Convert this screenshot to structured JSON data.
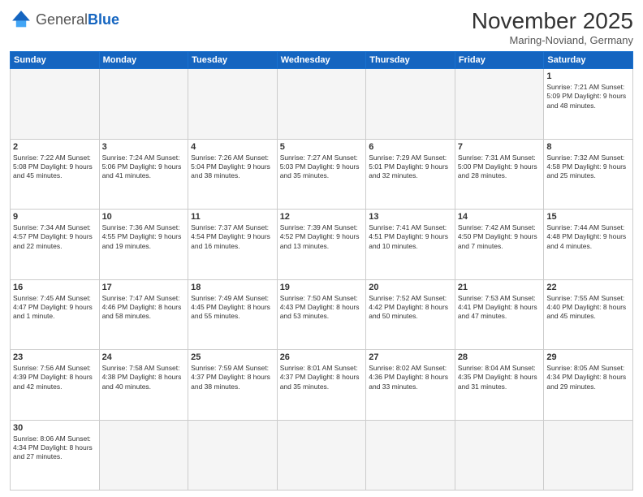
{
  "logo": {
    "general": "General",
    "blue": "Blue"
  },
  "title": "November 2025",
  "location": "Maring-Noviand, Germany",
  "headers": [
    "Sunday",
    "Monday",
    "Tuesday",
    "Wednesday",
    "Thursday",
    "Friday",
    "Saturday"
  ],
  "rows": [
    [
      {
        "num": "",
        "info": "",
        "empty": true
      },
      {
        "num": "",
        "info": "",
        "empty": true
      },
      {
        "num": "",
        "info": "",
        "empty": true
      },
      {
        "num": "",
        "info": "",
        "empty": true
      },
      {
        "num": "",
        "info": "",
        "empty": true
      },
      {
        "num": "",
        "info": "",
        "empty": true
      },
      {
        "num": "1",
        "info": "Sunrise: 7:21 AM\nSunset: 5:09 PM\nDaylight: 9 hours\nand 48 minutes.",
        "empty": false
      }
    ],
    [
      {
        "num": "2",
        "info": "Sunrise: 7:22 AM\nSunset: 5:08 PM\nDaylight: 9 hours\nand 45 minutes.",
        "empty": false
      },
      {
        "num": "3",
        "info": "Sunrise: 7:24 AM\nSunset: 5:06 PM\nDaylight: 9 hours\nand 41 minutes.",
        "empty": false
      },
      {
        "num": "4",
        "info": "Sunrise: 7:26 AM\nSunset: 5:04 PM\nDaylight: 9 hours\nand 38 minutes.",
        "empty": false
      },
      {
        "num": "5",
        "info": "Sunrise: 7:27 AM\nSunset: 5:03 PM\nDaylight: 9 hours\nand 35 minutes.",
        "empty": false
      },
      {
        "num": "6",
        "info": "Sunrise: 7:29 AM\nSunset: 5:01 PM\nDaylight: 9 hours\nand 32 minutes.",
        "empty": false
      },
      {
        "num": "7",
        "info": "Sunrise: 7:31 AM\nSunset: 5:00 PM\nDaylight: 9 hours\nand 28 minutes.",
        "empty": false
      },
      {
        "num": "8",
        "info": "Sunrise: 7:32 AM\nSunset: 4:58 PM\nDaylight: 9 hours\nand 25 minutes.",
        "empty": false
      }
    ],
    [
      {
        "num": "9",
        "info": "Sunrise: 7:34 AM\nSunset: 4:57 PM\nDaylight: 9 hours\nand 22 minutes.",
        "empty": false
      },
      {
        "num": "10",
        "info": "Sunrise: 7:36 AM\nSunset: 4:55 PM\nDaylight: 9 hours\nand 19 minutes.",
        "empty": false
      },
      {
        "num": "11",
        "info": "Sunrise: 7:37 AM\nSunset: 4:54 PM\nDaylight: 9 hours\nand 16 minutes.",
        "empty": false
      },
      {
        "num": "12",
        "info": "Sunrise: 7:39 AM\nSunset: 4:52 PM\nDaylight: 9 hours\nand 13 minutes.",
        "empty": false
      },
      {
        "num": "13",
        "info": "Sunrise: 7:41 AM\nSunset: 4:51 PM\nDaylight: 9 hours\nand 10 minutes.",
        "empty": false
      },
      {
        "num": "14",
        "info": "Sunrise: 7:42 AM\nSunset: 4:50 PM\nDaylight: 9 hours\nand 7 minutes.",
        "empty": false
      },
      {
        "num": "15",
        "info": "Sunrise: 7:44 AM\nSunset: 4:48 PM\nDaylight: 9 hours\nand 4 minutes.",
        "empty": false
      }
    ],
    [
      {
        "num": "16",
        "info": "Sunrise: 7:45 AM\nSunset: 4:47 PM\nDaylight: 9 hours\nand 1 minute.",
        "empty": false
      },
      {
        "num": "17",
        "info": "Sunrise: 7:47 AM\nSunset: 4:46 PM\nDaylight: 8 hours\nand 58 minutes.",
        "empty": false
      },
      {
        "num": "18",
        "info": "Sunrise: 7:49 AM\nSunset: 4:45 PM\nDaylight: 8 hours\nand 55 minutes.",
        "empty": false
      },
      {
        "num": "19",
        "info": "Sunrise: 7:50 AM\nSunset: 4:43 PM\nDaylight: 8 hours\nand 53 minutes.",
        "empty": false
      },
      {
        "num": "20",
        "info": "Sunrise: 7:52 AM\nSunset: 4:42 PM\nDaylight: 8 hours\nand 50 minutes.",
        "empty": false
      },
      {
        "num": "21",
        "info": "Sunrise: 7:53 AM\nSunset: 4:41 PM\nDaylight: 8 hours\nand 47 minutes.",
        "empty": false
      },
      {
        "num": "22",
        "info": "Sunrise: 7:55 AM\nSunset: 4:40 PM\nDaylight: 8 hours\nand 45 minutes.",
        "empty": false
      }
    ],
    [
      {
        "num": "23",
        "info": "Sunrise: 7:56 AM\nSunset: 4:39 PM\nDaylight: 8 hours\nand 42 minutes.",
        "empty": false
      },
      {
        "num": "24",
        "info": "Sunrise: 7:58 AM\nSunset: 4:38 PM\nDaylight: 8 hours\nand 40 minutes.",
        "empty": false
      },
      {
        "num": "25",
        "info": "Sunrise: 7:59 AM\nSunset: 4:37 PM\nDaylight: 8 hours\nand 38 minutes.",
        "empty": false
      },
      {
        "num": "26",
        "info": "Sunrise: 8:01 AM\nSunset: 4:37 PM\nDaylight: 8 hours\nand 35 minutes.",
        "empty": false
      },
      {
        "num": "27",
        "info": "Sunrise: 8:02 AM\nSunset: 4:36 PM\nDaylight: 8 hours\nand 33 minutes.",
        "empty": false
      },
      {
        "num": "28",
        "info": "Sunrise: 8:04 AM\nSunset: 4:35 PM\nDaylight: 8 hours\nand 31 minutes.",
        "empty": false
      },
      {
        "num": "29",
        "info": "Sunrise: 8:05 AM\nSunset: 4:34 PM\nDaylight: 8 hours\nand 29 minutes.",
        "empty": false
      }
    ],
    [
      {
        "num": "30",
        "info": "Sunrise: 8:06 AM\nSunset: 4:34 PM\nDaylight: 8 hours\nand 27 minutes.",
        "empty": false
      },
      {
        "num": "",
        "info": "",
        "empty": true
      },
      {
        "num": "",
        "info": "",
        "empty": true
      },
      {
        "num": "",
        "info": "",
        "empty": true
      },
      {
        "num": "",
        "info": "",
        "empty": true
      },
      {
        "num": "",
        "info": "",
        "empty": true
      },
      {
        "num": "",
        "info": "",
        "empty": true
      }
    ]
  ]
}
